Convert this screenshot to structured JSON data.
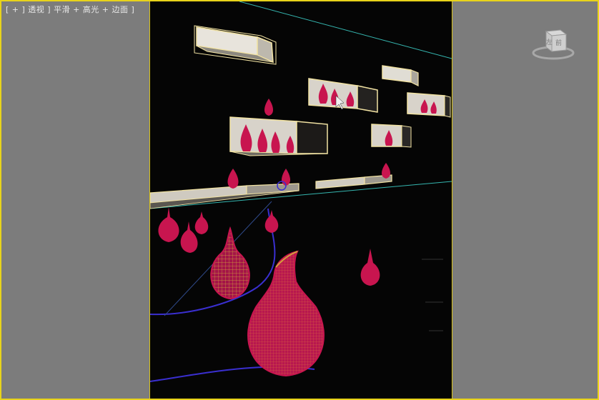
{
  "viewport": {
    "label": "[ + ] 透视 ] 平滑 + 高光 + 边面 ]",
    "viewcube_faces": {
      "left": "左",
      "front": "前"
    }
  },
  "colors": {
    "active_border": "#e8d31a",
    "safe_frame_bg": "#050505",
    "outer_bg": "#7c7c7c",
    "wireframe_pink": "#c8154f",
    "wireframe_yellow": "#c9a23a",
    "line_blue": "#3a2fd0",
    "line_cyan": "#35b6b0",
    "selection_box": "#f2e3a3"
  }
}
